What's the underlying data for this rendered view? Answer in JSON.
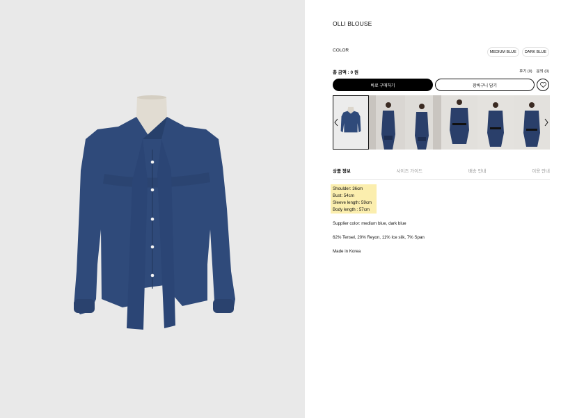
{
  "product": {
    "title": "OLLI BLOUSE",
    "image_alt_icon": "blouse-photo"
  },
  "options": {
    "color_label": "COLOR",
    "colors": [
      "MEDIUM BLUE",
      "DARK BLUE"
    ]
  },
  "summary": {
    "total": "총 금액 : 0 원",
    "review": "후기 (0)",
    "inquiry": "문의 (0)"
  },
  "actions": {
    "buy_now": "바로 구매하기",
    "add_cart": "장바구니 담기",
    "wishlist_icon": "heart-icon"
  },
  "gallery": {
    "prev_icon": "chevron-left-icon",
    "next_icon": "chevron-right-icon",
    "thumb_count": 6
  },
  "tabs": [
    "상품 정보",
    "사이즈 가이드",
    "배송 안내",
    "이용 안내"
  ],
  "details": {
    "sizes": [
      "Shoulder: 36cm",
      "Bust: 54cm",
      "Sleeve length: 59cm",
      "Body length : 57cm"
    ],
    "supplier_color": "Supplier color: medium blue, dark blue",
    "material": "62% Tensel, 20% Reyon, 11% Ice silk, 7% Span",
    "origin": "Made in Korea"
  },
  "colors": {
    "denim": "#2f4a7a",
    "denim_dark": "#24395f",
    "left_bg": "#e9e9e9",
    "highlight": "#fbeeae"
  }
}
